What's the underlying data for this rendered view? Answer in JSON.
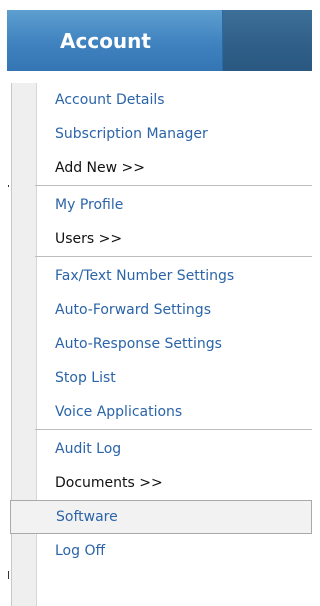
{
  "header": {
    "title": "Account"
  },
  "menu": {
    "account_details": "Account Details",
    "subscription_manager": "Subscription Manager",
    "add_new": "Add New >>",
    "my_profile": "My Profile",
    "users": "Users >>",
    "fax_text_number_settings": "Fax/Text Number Settings",
    "auto_forward_settings": "Auto-Forward Settings",
    "auto_response_settings": "Auto-Response Settings",
    "stop_list": "Stop List",
    "voice_applications": "Voice Applications",
    "audit_log": "Audit Log",
    "documents": "Documents >>",
    "software": "Software",
    "log_off": "Log Off"
  },
  "colors": {
    "header_blue": "#3f82bf",
    "header_dark": "#2f5f88",
    "link_blue": "#2b64a8",
    "selected_bg": "#f2f2f2"
  }
}
